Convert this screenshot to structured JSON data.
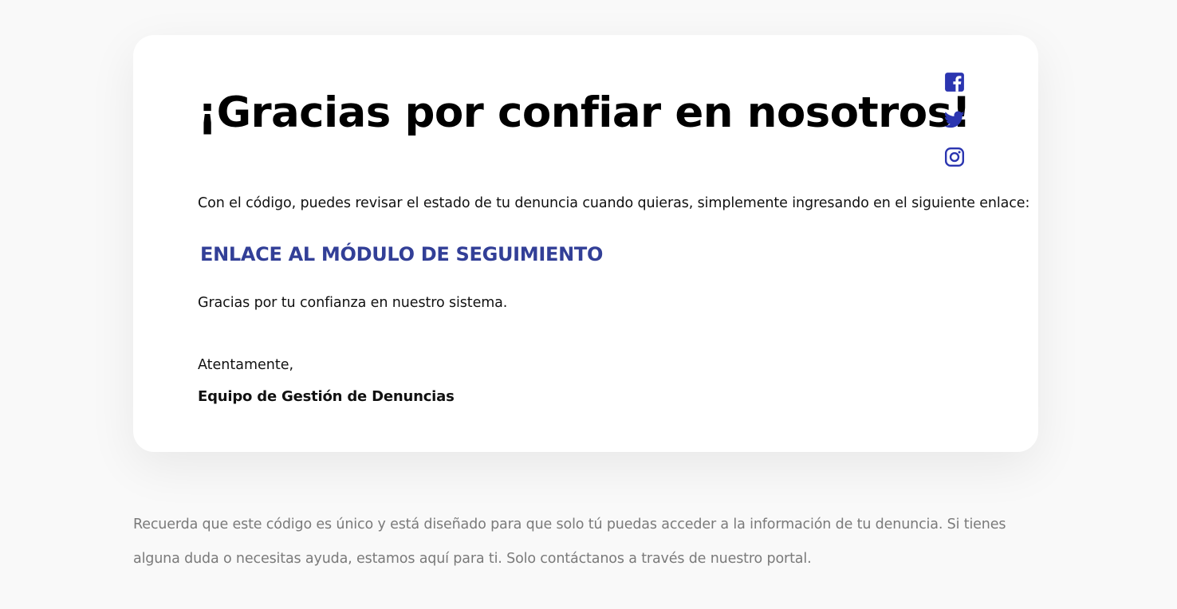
{
  "card": {
    "headline": "¡Gracias por confiar en nosotros!",
    "intro": "Con el código, puedes revisar el estado de tu denuncia cuando quieras, simplemente ingresando en el siguiente enlace:",
    "link_label": "ENLACE AL MÓDULO DE SEGUIMIENTO",
    "thanks": "Gracias por tu confianza en nuestro sistema.",
    "closing": "Atentamente,",
    "signature": "Equipo de Gestión de Denuncias"
  },
  "social": [
    {
      "icon": "facebook-icon"
    },
    {
      "icon": "twitter-icon"
    },
    {
      "icon": "instagram-icon"
    }
  ],
  "footer": {
    "note": "Recuerda que este código es único y está diseñado para que solo tú puedas acceder a la información de tu denuncia. Si tienes alguna duda o necesitas ayuda, estamos aquí para ti. Solo contáctanos a través de nuestro portal."
  },
  "colors": {
    "background": "#f9f9f9",
    "card": "#ffffff",
    "link": "#323f97",
    "social_icons": "#2b35b0",
    "footer_text": "#7a7a7a"
  }
}
